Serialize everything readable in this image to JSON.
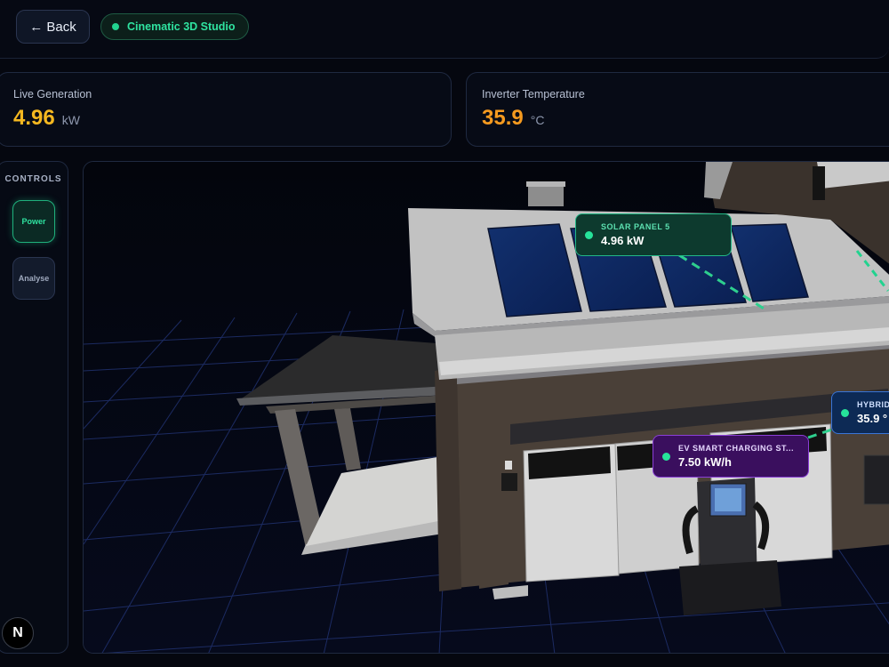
{
  "header": {
    "back_label": "← Back",
    "badge_label": "Cinematic 3D Studio"
  },
  "stats": {
    "generation": {
      "label": "Live Generation",
      "value": "4.96",
      "unit": "kW",
      "color": "#f5b820"
    },
    "temperature": {
      "label": "Inverter Temperature",
      "value": "35.9",
      "unit": "°C",
      "color": "#f59a1f"
    }
  },
  "controls": {
    "title": "CONTROLS",
    "power_label": "Power",
    "analyse_label": "Analyse"
  },
  "logo_letter": "N",
  "scene": {
    "solar_tag": {
      "title": "SOLAR PANEL 5",
      "value": "4.96 kW"
    },
    "ev_tag": {
      "title": "EV SMART CHARGING ST...",
      "value": "7.50 kW/h"
    },
    "hybrid_tag": {
      "title": "HYBRID",
      "value": "35.9 °"
    }
  },
  "colors": {
    "accent_green": "#22d38f",
    "grid_blue": "#1f2f6a"
  }
}
